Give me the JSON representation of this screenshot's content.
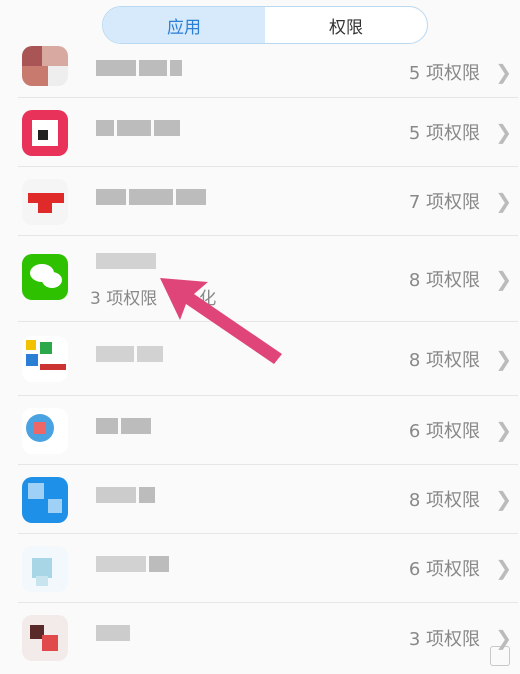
{
  "tabs": [
    {
      "label": "应用",
      "active": true
    },
    {
      "label": "权限",
      "active": false
    }
  ],
  "apps": [
    {
      "permissions": "5 项权限"
    },
    {
      "permissions": "5 项权限"
    },
    {
      "permissions": "7 项权限"
    },
    {
      "permissions": "8 项权限",
      "subtitle": "3 项权限",
      "subtitle_tail": "化"
    },
    {
      "permissions": "8 项权限"
    },
    {
      "permissions": "6 项权限"
    },
    {
      "permissions": "8 项权限"
    },
    {
      "permissions": "6 项权限"
    },
    {
      "permissions": "3 项权限"
    }
  ],
  "colors": {
    "accent": "#2a7fd4",
    "tab_active_bg": "#d6eafb",
    "arrow": "#e0457a",
    "wechat_green": "#2dc100"
  },
  "icons": {
    "chevron": "chevron-right-icon"
  }
}
